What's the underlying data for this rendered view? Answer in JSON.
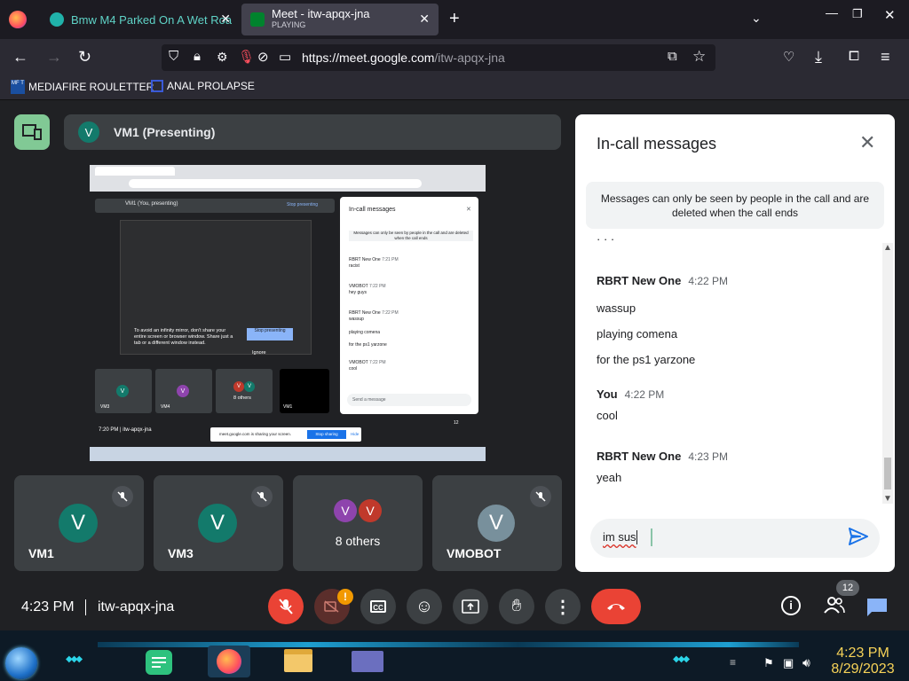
{
  "browser": {
    "tabs": [
      {
        "title": "Bmw M4 Parked On A Wet Roa",
        "active": false
      },
      {
        "title": "Meet - itw-apqx-jna",
        "status": "PLAYING",
        "active": true
      }
    ],
    "url_host": "https://meet.google.com",
    "url_path": "/itw-apqx-jna",
    "bookmarks": [
      {
        "icon_text": "MF T",
        "label": "MEDIAFIRE ROULETTER"
      },
      {
        "label": "ANAL PROLAPSE"
      }
    ]
  },
  "meet": {
    "presenter": {
      "initial": "V",
      "label": "VM1 (Presenting)"
    },
    "participants": [
      {
        "name": "VM1",
        "initial": "V",
        "color": "#137a6b",
        "muted": true
      },
      {
        "name": "VM3",
        "initial": "V",
        "color": "#137a6b",
        "muted": true
      },
      {
        "name": "8 others",
        "initials": [
          "V",
          "V"
        ],
        "colors": [
          "#8e44ad",
          "#c0392b"
        ]
      },
      {
        "name": "VMOBOT",
        "initial": "V",
        "color": "#78909c",
        "muted": true
      }
    ],
    "bottom": {
      "time": "4:23 PM",
      "meeting_code": "itw-apqx-jna",
      "people_count": "12"
    },
    "inner_screenshot": {
      "title_bar": "VM1 (You, presenting)",
      "stop_presenting": "Stop presenting",
      "chat_title": "In-call messages",
      "note": "Messages can only be seen by people in the call and are deleted when the call ends",
      "infinity_warning": "To avoid an infinity mirror, don't share your entire screen or browser window. Share just a tab or a different window instead.",
      "stop_btn": "Stop presenting",
      "ignore": "Ignore",
      "tiles": [
        "VM3",
        "VM4",
        "8 others",
        "VM1"
      ],
      "time": "7:20 PM",
      "code": "itw-apqx-jna",
      "sharing": "meet.google.com is sharing your screen.",
      "stop_sharing": "Stop sharing",
      "hide": "Hide",
      "send_placeholder": "Send a message",
      "count": "12",
      "messages": [
        {
          "sender": "RBRT New One",
          "time": "7:21 PM",
          "text": "racist"
        },
        {
          "sender": "VMOBOT",
          "time": "7:22 PM",
          "text": "hey guys"
        },
        {
          "sender": "RBRT New One",
          "time": "7:22 PM",
          "text": "wassup"
        },
        {
          "sender": "",
          "time": "",
          "text": "playing comena"
        },
        {
          "sender": "",
          "time": "",
          "text": "for the ps1 yarzone"
        },
        {
          "sender": "VMOBOT",
          "time": "7:22 PM",
          "text": "cool"
        }
      ]
    }
  },
  "chat": {
    "title": "In-call messages",
    "note": "Messages can only be seen by people in the call and are deleted when the call ends",
    "messages": [
      {
        "sender": "RBRT New One",
        "time": "4:22 PM",
        "lines": [
          "wassup",
          "playing comena",
          "for the ps1 yarzone"
        ]
      },
      {
        "sender": "You",
        "time": "4:22 PM",
        "lines": [
          "cool"
        ]
      },
      {
        "sender": "RBRT New One",
        "time": "4:23 PM",
        "lines": [
          "yeah"
        ]
      }
    ],
    "input_value": "im sus"
  },
  "taskbar": {
    "time": "4:23 PM",
    "date": "8/29/2023"
  },
  "colors": {
    "accent_blue": "#1a73e8",
    "end_call_red": "#ea4335",
    "meet_bg": "#202124",
    "tile_bg": "#3c4043"
  }
}
